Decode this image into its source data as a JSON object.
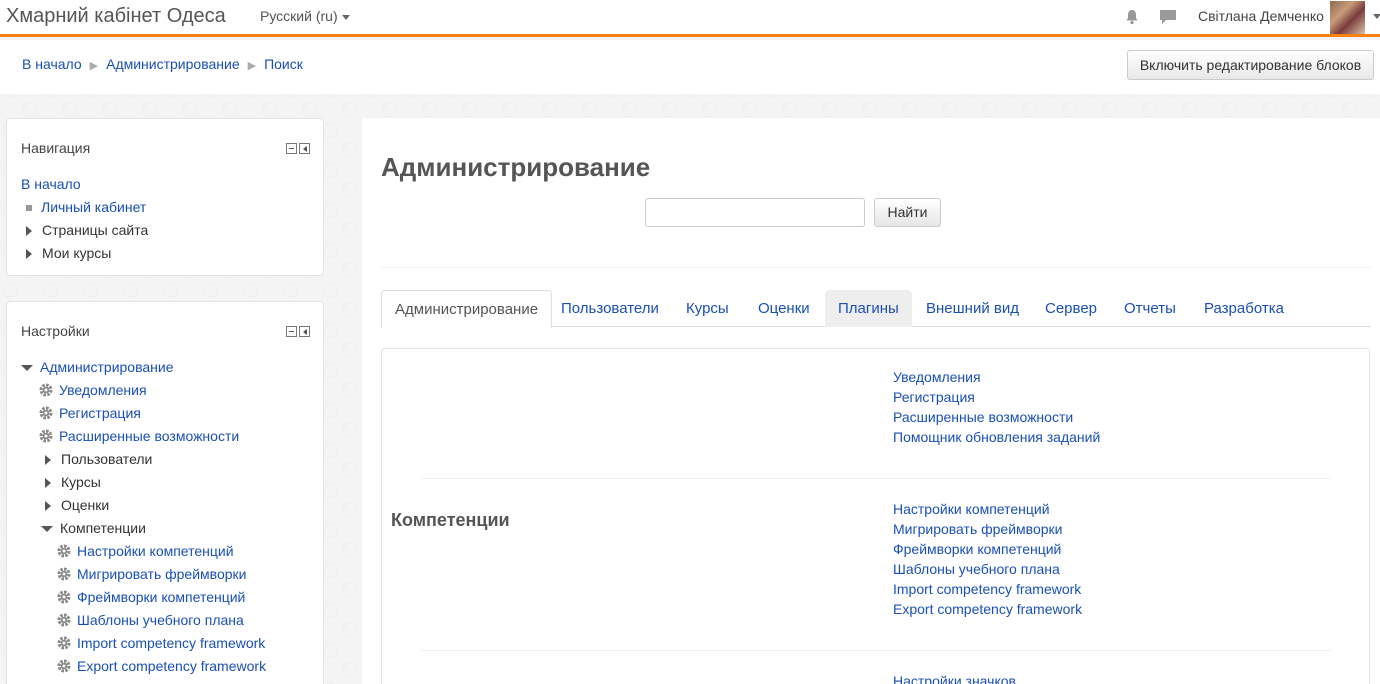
{
  "navbar": {
    "site_name": "Хмарний кабінет Одеса",
    "language": "Русский (ru)",
    "user_name": "Світлана Демченко",
    "accent_color": "#f98012",
    "icons": [
      "bell-icon",
      "chat-icon"
    ]
  },
  "breadcrumb": {
    "items": [
      "В начало",
      "Администрирование",
      "Поиск"
    ]
  },
  "edit_blocks_label": "Включить редактирование блоков",
  "nav_block": {
    "title": "Навигация",
    "items": [
      "В начало",
      "Личный кабинет",
      "Страницы сайта",
      "Мои курсы"
    ]
  },
  "settings_block": {
    "title": "Настройки",
    "root": "Администрирование",
    "items": [
      "Уведомления",
      "Регистрация",
      "Расширенные возможности",
      "Пользователи",
      "Курсы",
      "Оценки",
      "Компетенции"
    ],
    "competency_items": [
      "Настройки компетенций",
      "Мигрировать фреймворки",
      "Фреймворки компетенций",
      "Шаблоны учебного плана",
      "Import competency framework",
      "Export competency framework"
    ]
  },
  "main": {
    "title": "Администрирование",
    "search_button": "Найти",
    "search_value": "",
    "tabs": [
      "Администрирование",
      "Пользователи",
      "Курсы",
      "Оценки",
      "Плагины",
      "Внешний вид",
      "Сервер",
      "Отчеты",
      "Разработка"
    ],
    "general_links": [
      "Уведомления",
      "Регистрация",
      "Расширенные возможности",
      "Помощник обновления заданий"
    ],
    "competencies_title": "Компетенции",
    "competency_links": [
      "Настройки компетенций",
      "Мигрировать фреймворки",
      "Фреймворки компетенций",
      "Шаблоны учебного плана",
      "Import competency framework",
      "Export competency framework"
    ],
    "badges_first_link": "Настройки значков"
  }
}
